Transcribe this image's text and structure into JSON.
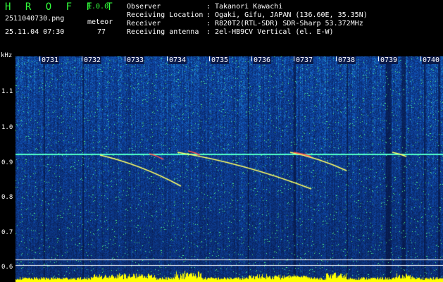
{
  "header": {
    "logo": "H R O F F T",
    "version": "1.0.0",
    "filename": "2511040730.png",
    "type_label": "meteor",
    "datetime": "25.11.04 07:30",
    "count": "77"
  },
  "info": [
    {
      "label": "Observer",
      "value": "Takanori Kawachi"
    },
    {
      "label": "Receiving Location",
      "value": "Ogaki, Gifu, JAPAN (136.60E, 35.35N)"
    },
    {
      "label": "Receiver",
      "value": "R820T2(RTL-SDR) SDR-Sharp 53.372MHz"
    },
    {
      "label": "Receiving antenna",
      "value": "2el-HB9CV Vertical (el. E-W)"
    }
  ],
  "separator": ":",
  "y_axis": {
    "unit": "kHz",
    "ticks": [
      "1.1",
      "1.0",
      "0.9",
      "0.8",
      "0.7",
      "0.6"
    ]
  },
  "time_axis": {
    "ticks": [
      "0731",
      "0732",
      "0733",
      "0734",
      "0735",
      "0736",
      "0737",
      "0738",
      "0739",
      "0740"
    ]
  },
  "colors": {
    "logo": "#32ff3c",
    "text": "#ffffff",
    "noise_low": "#0a1e78",
    "noise_high": "#28c8ff",
    "signal": "#ffff64",
    "meteor_hot": "#ff5050",
    "level_bar": "#ffff00"
  }
}
